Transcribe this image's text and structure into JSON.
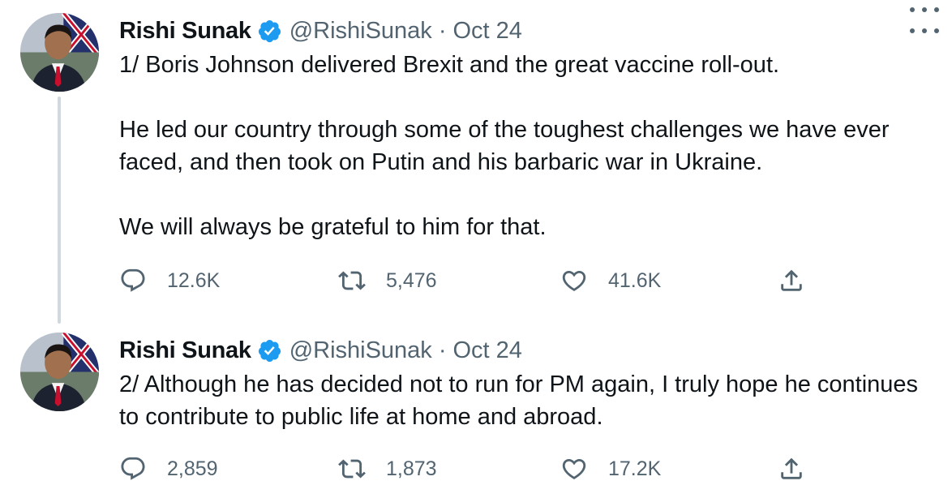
{
  "tweets": [
    {
      "author_name": "Rishi Sunak",
      "handle": "@RishiSunak",
      "separator": "·",
      "date": "Oct 24",
      "text": [
        "1/ Boris Johnson delivered Brexit and the great vaccine roll-out.",
        "He led our country through some of the toughest challenges we have ever faced, and then took on Putin and his barbaric war in Ukraine.",
        "We will always be grateful to him for that."
      ],
      "replies": "12.6K",
      "retweets": "5,476",
      "likes": "41.6K"
    },
    {
      "author_name": "Rishi Sunak",
      "handle": "@RishiSunak",
      "separator": "·",
      "date": "Oct 24",
      "text": [
        "2/ Although he has decided not to run for PM again, I truly hope he continues to contribute to public life at home and abroad."
      ],
      "replies": "2,859",
      "retweets": "1,873",
      "likes": "17.2K"
    }
  ],
  "icons": {
    "verified": "verified-badge-icon",
    "more": "more-horizontal-icon",
    "reply": "reply-bubble-icon",
    "retweet": "retweet-icon",
    "like": "heart-icon",
    "share": "share-upload-icon"
  },
  "colors": {
    "text": "#0f1419",
    "secondary": "#536471",
    "verified": "#1d9bf0",
    "thread_line": "#cfd9de"
  }
}
